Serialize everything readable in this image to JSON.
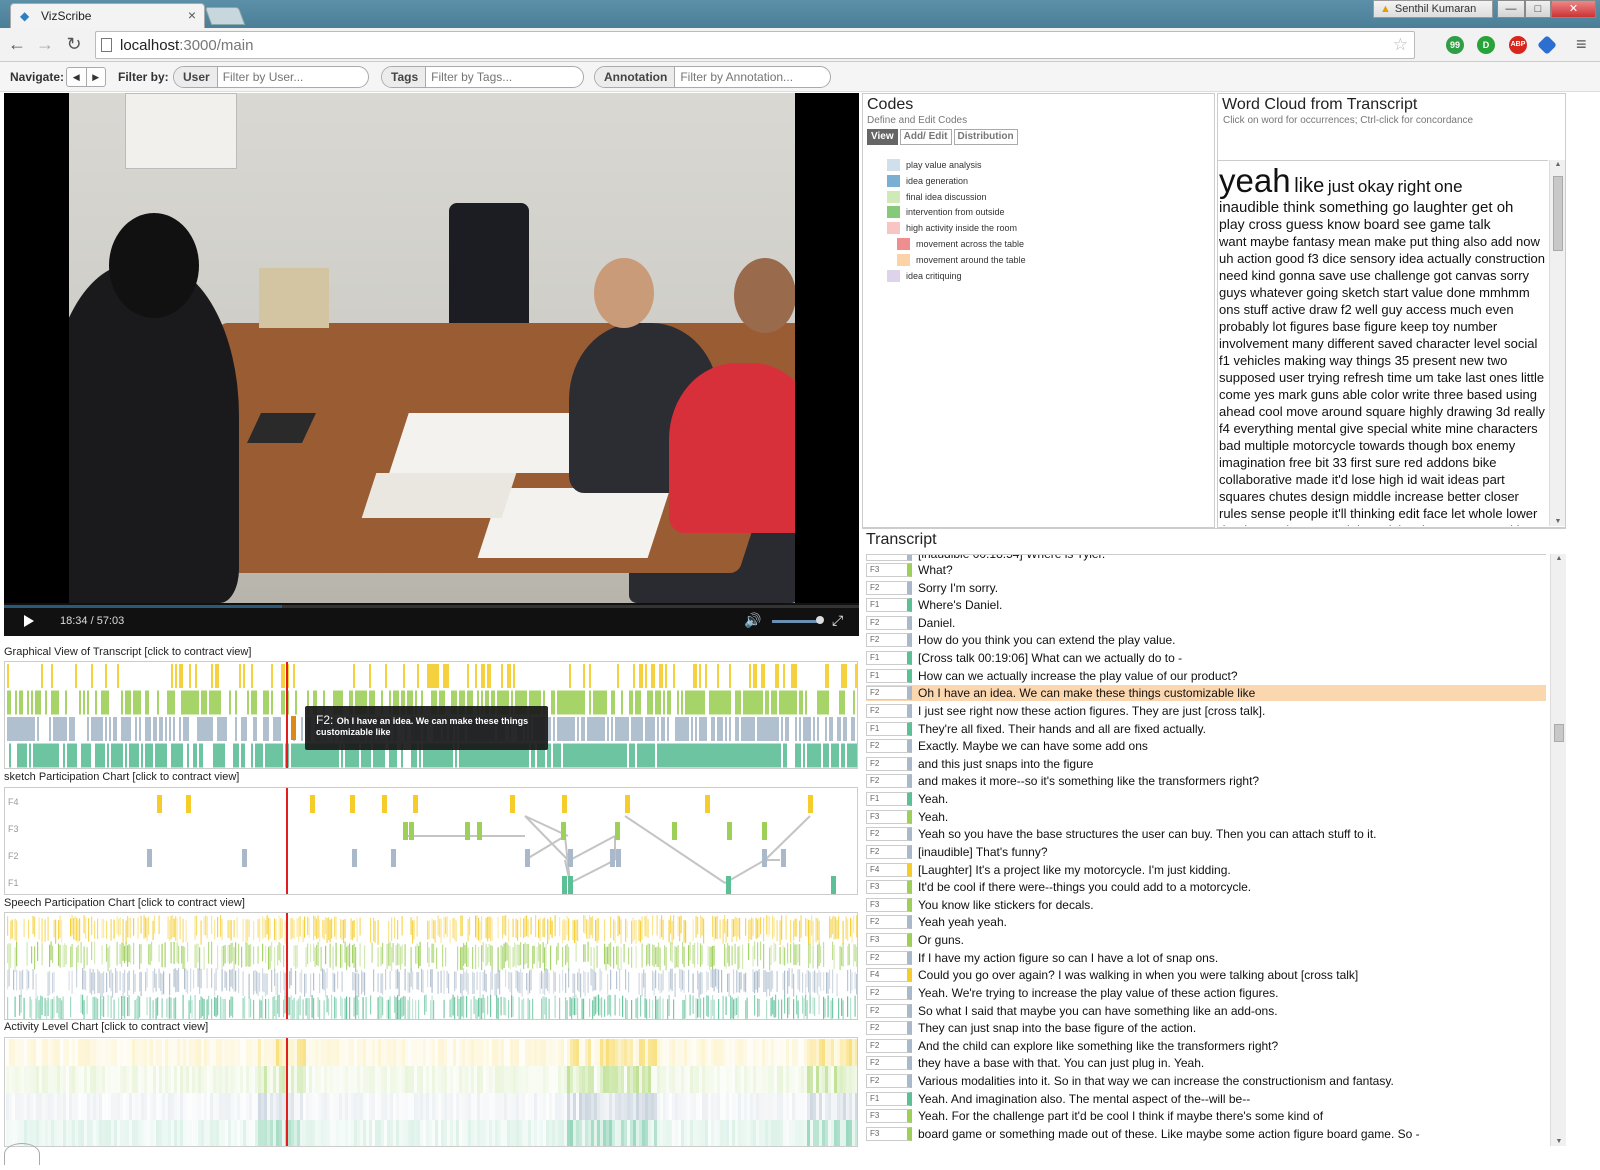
{
  "browser": {
    "tab_title": "VizScribe",
    "tab_close": "×",
    "user_name": "Senthil Kumaran",
    "url_host": "localhost",
    "url_rest": ":3000/main",
    "ext_1": "99",
    "ext_2": "D",
    "ext_3": "ABP",
    "win_min": "—",
    "win_max": "□",
    "win_close": "✕",
    "back": "←",
    "forward": "→",
    "reload": "↻",
    "star": "☆",
    "menu": "≡"
  },
  "appbar": {
    "navigate_label": "Navigate:",
    "prev": "◀",
    "next": "▶",
    "filter_label": "Filter by:",
    "user_label": "User",
    "user_placeholder": "Filter by User...",
    "tags_label": "Tags",
    "tags_placeholder": "Filter by Tags...",
    "annotation_label": "Annotation",
    "annotation_placeholder": "Filter by Annotation..."
  },
  "video": {
    "time": "18:34  /  57:03",
    "progress": 0.325,
    "volume": 0.9,
    "volume_icon": "🔊",
    "fullscreen_icon": "⤢"
  },
  "panels": {
    "graphical_title": "Graphical View of Transcript [click to contract view]",
    "sketch_title": "sketch Participation Chart [click to contract view]",
    "speech_title": "Speech Participation Chart [click to contract view]",
    "activity_title": "Activity Level Chart [click to contract view]",
    "rows": [
      "F4",
      "F3",
      "F2",
      "F1"
    ]
  },
  "tooltip": {
    "speaker": "F2:",
    "text": "Oh I have an idea. We can make these things customizable like"
  },
  "colors": {
    "F1": "#5cbf96",
    "F2": "#a9b9c9",
    "F3": "#9dcf59",
    "F4": "#f5cc2a",
    "playhead": "#e21d1d",
    "highlight": "#fbd7b0"
  },
  "codes": {
    "title": "Codes",
    "subtitle": "Define and Edit Codes",
    "tabs": [
      "View",
      "Add/ Edit",
      "Distribution"
    ],
    "items": [
      {
        "label": "play value analysis",
        "color": "#cfe0ec",
        "indent": 0
      },
      {
        "label": "idea generation",
        "color": "#7aaed3",
        "indent": 0
      },
      {
        "label": "final idea discussion",
        "color": "#cfe9b8",
        "indent": 0
      },
      {
        "label": "intervention from outside",
        "color": "#86c978",
        "indent": 0
      },
      {
        "label": "high activity inside the room",
        "color": "#f9c4c4",
        "indent": 0
      },
      {
        "label": "movement across the table",
        "color": "#ef8e8e",
        "indent": 1
      },
      {
        "label": "movement around the table",
        "color": "#fcd3a6",
        "indent": 1
      },
      {
        "label": "idea critiquing",
        "color": "#ddd3ea",
        "indent": 0
      }
    ]
  },
  "wordcloud": {
    "title": "Word Cloud from Transcript",
    "subtitle": "Click on word for occurrences; Ctrl-click for concordance",
    "w_yeah": "yeah",
    "w_like": "like",
    "w_just": "just",
    "w_okay": "okay",
    "w_right": "right",
    "w_one": "one",
    "line2": "inaudible think something go laughter get oh",
    "line3": "play cross guess know board see game talk",
    "rest": "want maybe fantasy mean make put thing also add now uh action good f3 dice sensory idea actually construction need kind gonna save use challenge got canvas sorry guys whatever going sketch start value done mmhmm ons stuff active draw f2 well guy access much even probably lot figures base figure keep toy number involvement many different saved character level social f1 vehicles making way things 35 present new two supposed user trying refresh time um take last ones little come yes mark guns able color write three based using ahead cool move around square highly drawing 3d really f4 everything mental give special white mine characters bad multiple motorcycle towards though box enemy imagination free bit 33 first sure red addons bike collaborative made it'd lose high id wait ideas part squares chutes design middle increase better closer rules sense people it'll thinking edit face let whole lower thanks numbers set might activity giant means working side daniel look obviously pyramid gun scamper products sensor choose change 3d big ready exists skin moving"
  },
  "transcript": {
    "title": "Transcript",
    "top_partial": "[inaudible 00:18:54] Where is Tyler.",
    "rows": [
      {
        "spk": "F3",
        "text": "What?"
      },
      {
        "spk": "F2",
        "text": "Sorry I'm sorry."
      },
      {
        "spk": "F1",
        "text": "Where's Daniel."
      },
      {
        "spk": "F2",
        "text": "Daniel."
      },
      {
        "spk": "F2",
        "text": "How do you think you can extend the play value."
      },
      {
        "spk": "F1",
        "text": "[Cross talk 00:19:06] What can we actually do to -"
      },
      {
        "spk": "F1",
        "text": "How can we actually increase the play value of our product?"
      },
      {
        "spk": "F2",
        "text": "Oh I have an idea. We can make these things customizable like",
        "hl": true
      },
      {
        "spk": "F2",
        "text": "I just see right now these action figures. They are just [cross talk]."
      },
      {
        "spk": "F1",
        "text": "They're all fixed. Their hands and all are fixed actually."
      },
      {
        "spk": "F2",
        "text": "Exactly. Maybe we can have some add ons"
      },
      {
        "spk": "F2",
        "text": "and this just snaps into the figure"
      },
      {
        "spk": "F2",
        "text": "and makes it more--so it's something like the transformers right?"
      },
      {
        "spk": "F1",
        "text": "Yeah."
      },
      {
        "spk": "F3",
        "text": "Yeah."
      },
      {
        "spk": "F2",
        "text": "Yeah so you have the base structures the user can buy. Then you can attach stuff to it."
      },
      {
        "spk": "F2",
        "text": "[inaudible] That's funny?"
      },
      {
        "spk": "F4",
        "text": "[Laughter] It's a project like my motorcycle. I'm just kidding."
      },
      {
        "spk": "F3",
        "text": "It'd be cool if there were--things you could add to a motorcycle."
      },
      {
        "spk": "F3",
        "text": "You know like stickers for decals."
      },
      {
        "spk": "F2",
        "text": "Yeah yeah yeah."
      },
      {
        "spk": "F3",
        "text": "Or guns."
      },
      {
        "spk": "F2",
        "text": "If I have my action figure so can I have a lot of snap ons."
      },
      {
        "spk": "F4",
        "text": "Could you go over again? I was walking in when you were talking about [cross talk]"
      },
      {
        "spk": "F2",
        "text": "Yeah. We're trying to increase the play value of these action figures."
      },
      {
        "spk": "F2",
        "text": "So what I said that maybe you can have something like an add-ons."
      },
      {
        "spk": "F2",
        "text": "They can just snap into the base figure of the action."
      },
      {
        "spk": "F2",
        "text": "And the child can explore like something like the transformers right?"
      },
      {
        "spk": "F2",
        "text": "they have a base with that. You can just plug in. Yeah."
      },
      {
        "spk": "F2",
        "text": "Various modalities into it. So in that way we can increase the constructionism and fantasy."
      },
      {
        "spk": "F1",
        "text": "Yeah. And imagination also. The mental aspect of the--will be--"
      },
      {
        "spk": "F3",
        "text": "Yeah. For the challenge part it'd be cool I think if maybe there's some kind of"
      },
      {
        "spk": "F3",
        "text": "board game or something made out of these. Like maybe some action figure board game. So -"
      }
    ]
  }
}
